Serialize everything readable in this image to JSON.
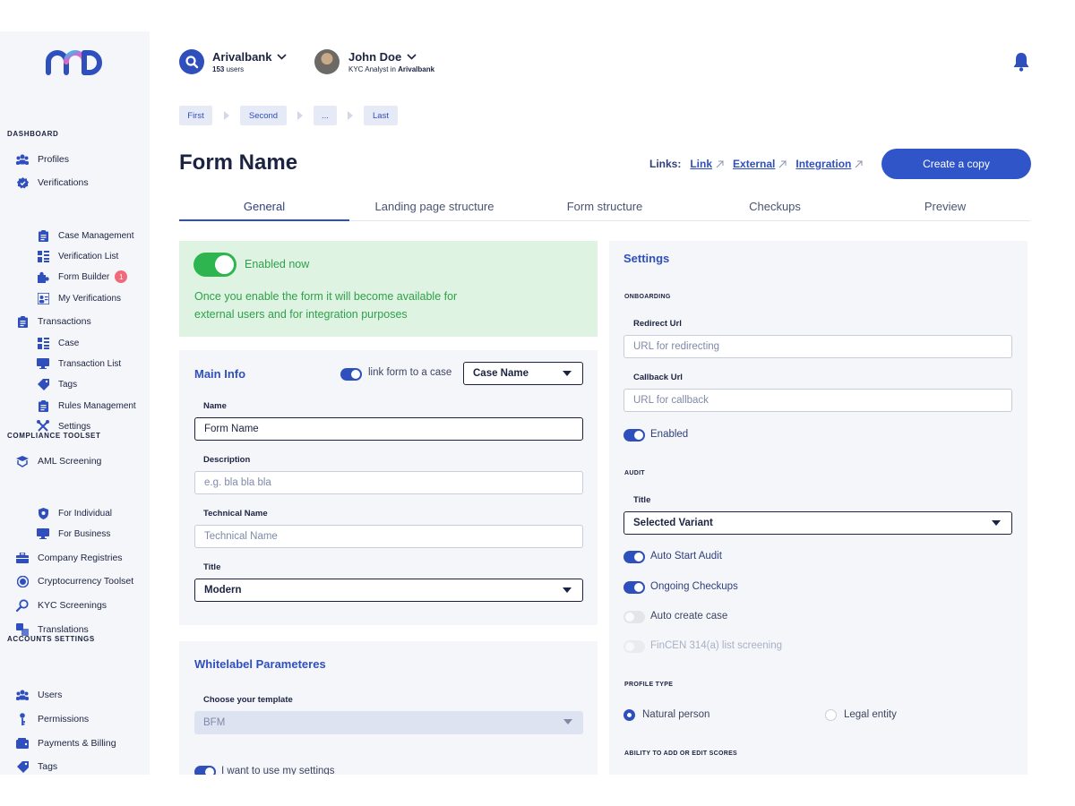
{
  "sidebar": {
    "sections": {
      "dashboard": "DASHBOARD",
      "compliance": "COMPLIANCE TOOLSET",
      "accounts": "ACCOUNTS SETTINGS"
    },
    "items": {
      "profiles": "Profiles",
      "verifications": "Verifications",
      "case_management": "Case Management",
      "verification_list": "Verification List",
      "form_builder": "Form Builder",
      "form_builder_badge": "1",
      "my_verifications": "My Verifications",
      "transactions": "Transactions",
      "case": "Case",
      "transaction_list": "Transaction List",
      "tags": "Tags",
      "rules_management": "Rules Management",
      "settings": "Settings",
      "aml_screening": "AML Screening",
      "for_individual": "For Individual",
      "for_business": "For Business",
      "company_registries": "Company Registries",
      "crypto_toolset": "Cryptocurrency Toolset",
      "kyc_screenings": "KYC Screenings",
      "translations": "Translations",
      "users": "Users",
      "permissions": "Permissions",
      "payments_billing": "Payments & Billing",
      "tags2": "Tags"
    }
  },
  "header": {
    "org_name": "Arivalbank",
    "org_users_count": "153",
    "org_users_suffix": " users",
    "user_name": "John Doe",
    "user_role_prefix": "KYC Analyst in ",
    "user_role_org": "Arivalbank"
  },
  "breadcrumb": [
    "First",
    "Second",
    "...",
    "Last"
  ],
  "page": {
    "title": "Form Name",
    "links_label": "Links:",
    "links": [
      "Link",
      "External",
      "Integration"
    ],
    "copy_button": "Create a copy"
  },
  "tabs": [
    "General",
    "Landing page structure",
    "Form structure",
    "Checkups",
    "Preview"
  ],
  "enable": {
    "label": "Enabled now",
    "description": "Once you enable the form it will become available for external users and for integration purposes",
    "on": true
  },
  "main_info": {
    "title": "Main Info",
    "link_toggle_label": "link form to a case",
    "case_select": "Case Name",
    "name_label": "Name",
    "name_value": "Form Name",
    "description_label": "Description",
    "description_placeholder": "e.g. bla bla bla",
    "technical_label": "Technical Name",
    "technical_placeholder": "Technical Name",
    "title_label": "Title",
    "title_value": "Modern"
  },
  "whitelabel": {
    "title": "Whitelabel Parameteres",
    "template_label": "Choose your template",
    "template_value": "BFM",
    "own_settings_label": "I want to use my settings"
  },
  "settings": {
    "title": "Settings",
    "onboarding_caption": "ONBOARDING",
    "redirect_label": "Redirect Url",
    "redirect_placeholder": "URL for redirecting",
    "callback_label": "Callback Url",
    "callback_placeholder": "URL for callback",
    "enabled_label": "Enabled",
    "audit_caption": "AUDIT",
    "audit_title_label": "Title",
    "audit_title_value": "Selected Variant",
    "auto_start_audit": "Auto Start Audit",
    "ongoing_checkups": "Ongoing Checkups",
    "auto_create_case": "Auto create case",
    "fincen": "FinCEN 314(a) list screening",
    "profile_type_caption": "PROFILE TYPE",
    "natural_person": "Natural person",
    "legal_entity": "Legal entity",
    "scores_caption": "ABILITY TO ADD OR EDIT SCORES"
  },
  "colors": {
    "accent": "#2f4fbd",
    "success": "#2fb550",
    "badge": "#f06a7a",
    "panel_bg": "#f4f6fa"
  },
  "icons": [
    "org-search-icon",
    "bell-icon",
    "chevron-down-icon",
    "link-icon"
  ]
}
